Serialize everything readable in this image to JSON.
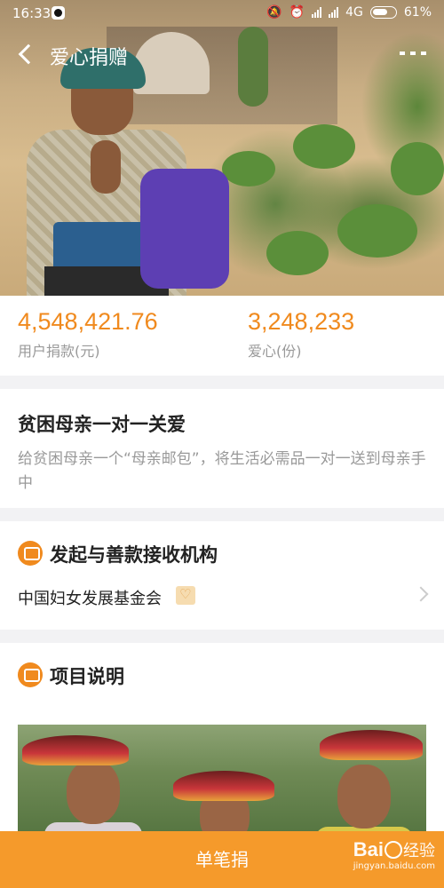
{
  "status_bar": {
    "time": "16:33",
    "network": "4G",
    "battery": "61%"
  },
  "nav": {
    "title": "爱心捐赠"
  },
  "stats": {
    "donation_amount": "4,548,421.76",
    "donation_label": "用户捐款(元)",
    "hearts_count": "3,248,233",
    "hearts_label": "爱心(份)"
  },
  "project": {
    "title": "贫困母亲一对一关爱",
    "description": "给贫困母亲一个“母亲邮包”，将生活必需品一对一送到母亲手中"
  },
  "organization": {
    "section_title": "发起与善款接收机构",
    "name": "中国妇女发展基金会"
  },
  "description_section": {
    "section_title": "项目说明"
  },
  "bottom_bar": {
    "donate_label": "单笔捐"
  },
  "watermark": {
    "brand_left": "Bai",
    "brand_right": "经验",
    "url": "jingyan.baidu.com"
  },
  "colors": {
    "accent": "#f08a1e",
    "donate_bar": "#f59a2b",
    "page_bg": "#f2f2f4"
  }
}
